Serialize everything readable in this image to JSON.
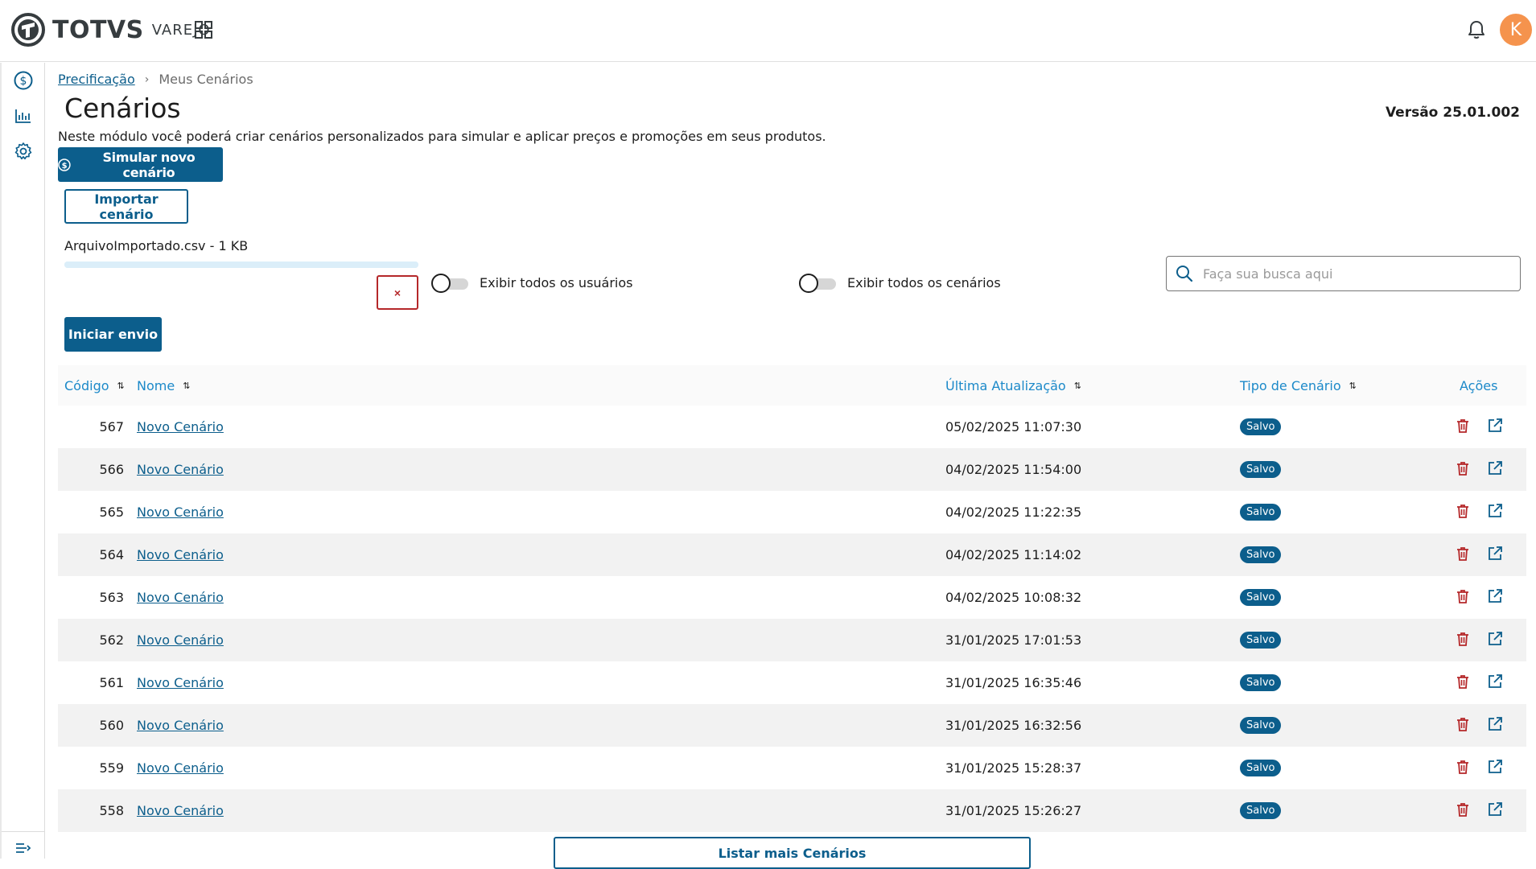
{
  "header": {
    "brand": "TOTVS",
    "product": "VAREJO",
    "avatar_initial": "K",
    "apps_icon": "grid-icon",
    "notification_icon": "bell-icon"
  },
  "sidebar": {
    "items": [
      {
        "icon": "dollar-circle-icon"
      },
      {
        "icon": "bar-chart-icon"
      },
      {
        "icon": "gear-icon"
      }
    ],
    "collapse_icon": "expand-menu-icon"
  },
  "breadcrumb": {
    "parent": "Precificação",
    "current": "Meus Cenários"
  },
  "page": {
    "title": "Cenários",
    "version": "Versão 25.01.002",
    "description": "Neste módulo você poderá criar cenários personalizados para simular e aplicar preços e promoções em seus produtos."
  },
  "actions": {
    "simulate_label": "Simular novo cenário",
    "import_label": "Importar cenário",
    "send_label": "Iniciar envio",
    "cancel_upload_label": "×",
    "more_label": "Listar mais Cenários"
  },
  "upload": {
    "file": "ArquivoImportado.csv - 1 KB",
    "progress": 1.0
  },
  "filters": {
    "show_all_users": "Exibir todos os usuários",
    "show_all_users_on": false,
    "show_all_scenarios": "Exibir todos os cenários",
    "show_all_scenarios_on": false,
    "search_placeholder": "Faça sua busca aqui"
  },
  "table": {
    "columns": {
      "code": "Código",
      "name": "Nome",
      "updated": "Última Atualização",
      "type": "Tipo de Cenário",
      "actions": "Ações"
    },
    "rows": [
      {
        "code": "567",
        "name": "Novo Cenário",
        "updated": "05/02/2025 11:07:30",
        "type": "Salvo"
      },
      {
        "code": "566",
        "name": "Novo Cenário",
        "updated": "04/02/2025 11:54:00",
        "type": "Salvo"
      },
      {
        "code": "565",
        "name": "Novo Cenário",
        "updated": "04/02/2025 11:22:35",
        "type": "Salvo"
      },
      {
        "code": "564",
        "name": "Novo Cenário",
        "updated": "04/02/2025 11:14:02",
        "type": "Salvo"
      },
      {
        "code": "563",
        "name": "Novo Cenário",
        "updated": "04/02/2025 10:08:32",
        "type": "Salvo"
      },
      {
        "code": "562",
        "name": "Novo Cenário",
        "updated": "31/01/2025 17:01:53",
        "type": "Salvo"
      },
      {
        "code": "561",
        "name": "Novo Cenário",
        "updated": "31/01/2025 16:35:46",
        "type": "Salvo"
      },
      {
        "code": "560",
        "name": "Novo Cenário",
        "updated": "31/01/2025 16:32:56",
        "type": "Salvo"
      },
      {
        "code": "559",
        "name": "Novo Cenário",
        "updated": "31/01/2025 15:28:37",
        "type": "Salvo"
      },
      {
        "code": "558",
        "name": "Novo Cenário",
        "updated": "31/01/2025 15:26:27",
        "type": "Salvo"
      }
    ]
  },
  "colors": {
    "primary": "#0c5e8c",
    "link": "#1c89c9",
    "danger": "#b5282a",
    "avatar": "#f5934d"
  }
}
